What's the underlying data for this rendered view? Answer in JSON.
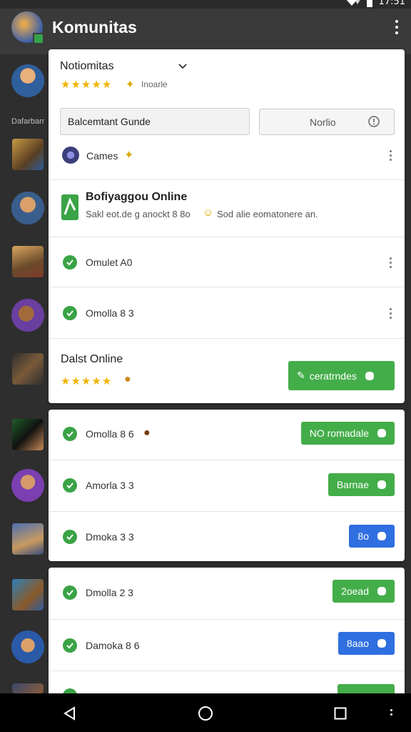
{
  "status": {
    "time": "17:51"
  },
  "appbar": {
    "title": "Komunitas"
  },
  "rail": {
    "section_label": "Dafarbarr"
  },
  "header_card": {
    "dropdown_title": "Notiomitas",
    "rating_text": "Inoarle",
    "search_value": "Balcemtant Gunde",
    "secondary_button": "Norlio",
    "games_label": "Cames"
  },
  "featured": {
    "title": "Bofiyaggou Online",
    "subtitle": "Sakl eot.de g anockt 8 8o",
    "subtitle_tail": "Sod alie eomatonere an."
  },
  "rows_a": [
    {
      "label": "Omulet A0"
    },
    {
      "label": "Omolla 8 3"
    }
  ],
  "dalst": {
    "title": "Dalst Online",
    "button": "ceratrndes"
  },
  "rows_b": [
    {
      "label": "Omolla 8 6",
      "button": "NO romadale",
      "color": "green"
    },
    {
      "label": "Amorla 3 3",
      "button": "Barnae",
      "color": "green"
    },
    {
      "label": "Dmoka 3 3",
      "button": "8o",
      "color": "blue"
    }
  ],
  "rows_c": [
    {
      "label": "Dmolla 2 3",
      "button": "2oead",
      "color": "green"
    },
    {
      "label": "Damoka 8 6",
      "button": "8aao",
      "color": "blue"
    }
  ],
  "colors": {
    "green": "#43ad49",
    "blue": "#2f6fe0",
    "check": "#3aa346"
  }
}
